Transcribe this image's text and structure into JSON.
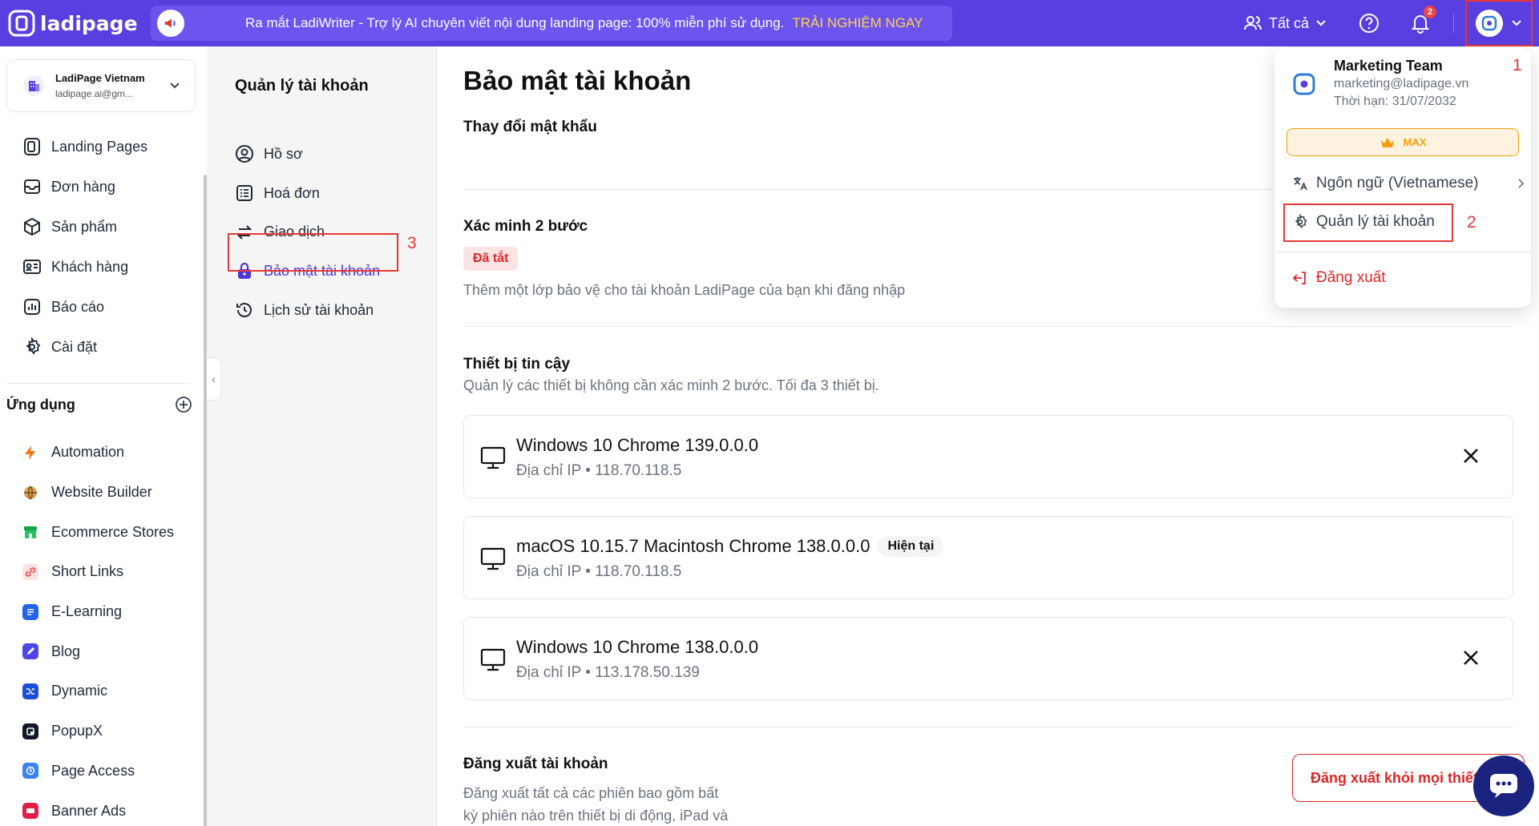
{
  "topbar": {
    "logo_text": "ladipage",
    "banner_text": "Ra mắt LadiWriter - Trợ lý AI chuyên viết nội dung landing page: 100% miễn phí sử dụng.",
    "banner_cta": "TRẢI NGHIỆM NGAY",
    "scope_label": "Tất cả",
    "notification_count": "2",
    "colors": {
      "bar": "#5a3fe0",
      "banner": "#6d54ef",
      "cta": "#ffd54a"
    }
  },
  "account": {
    "name": "LadiPage Vietnam",
    "email": "ladipage.ai@gm..."
  },
  "sidebar": {
    "nav": [
      {
        "label": "Landing Pages",
        "icon": "landing-pages-icon"
      },
      {
        "label": "Đơn hàng",
        "icon": "orders-icon"
      },
      {
        "label": "Sản phẩm",
        "icon": "products-icon"
      },
      {
        "label": "Khách hàng",
        "icon": "customers-icon"
      },
      {
        "label": "Báo cáo",
        "icon": "reports-icon"
      },
      {
        "label": "Cài đặt",
        "icon": "settings-icon"
      }
    ],
    "apps_title": "Ứng dụng",
    "apps": [
      {
        "label": "Automation",
        "icon": "automation-icon",
        "color": "#f97316"
      },
      {
        "label": "Website Builder",
        "icon": "website-builder-icon",
        "color": "#a16207"
      },
      {
        "label": "Ecommerce Stores",
        "icon": "ecommerce-icon",
        "color": "#16a34a"
      },
      {
        "label": "Short Links",
        "icon": "short-links-icon",
        "color": "#ef4444"
      },
      {
        "label": "E-Learning",
        "icon": "elearning-icon",
        "color": "#2563eb"
      },
      {
        "label": "Blog",
        "icon": "blog-icon",
        "color": "#4f46e5"
      },
      {
        "label": "Dynamic",
        "icon": "dynamic-icon",
        "color": "#1d4ed8"
      },
      {
        "label": "PopupX",
        "icon": "popupx-icon",
        "color": "#111827"
      },
      {
        "label": "Page Access",
        "icon": "page-access-icon",
        "color": "#3b82f6"
      },
      {
        "label": "Banner Ads",
        "icon": "banner-ads-icon",
        "color": "#e11d48"
      }
    ]
  },
  "subnav": {
    "title": "Quản lý tài khoản",
    "items": [
      {
        "label": "Hồ sơ",
        "icon": "profile-icon"
      },
      {
        "label": "Hoá đơn",
        "icon": "invoice-icon"
      },
      {
        "label": "Giao dịch",
        "icon": "transaction-icon"
      },
      {
        "label": "Bảo mật tài khoản",
        "icon": "lock-icon"
      },
      {
        "label": "Lịch sử tài khoản",
        "icon": "history-icon"
      }
    ]
  },
  "main": {
    "title": "Bảo mật tài khoản",
    "change_password": "Thay đổi mật khẩu",
    "two_factor_title": "Xác minh 2 bước",
    "two_factor_status": "Đã tắt",
    "two_factor_desc": "Thêm một lớp bảo vệ cho tài khoản LadiPage của bạn khi đăng nhập",
    "trusted_title": "Thiết bị tin cậy",
    "trusted_desc": "Quản lý các thiết bị không cần xác minh 2 bước. Tối đa 3 thiết bị.",
    "ip_prefix": "Địa chỉ IP •",
    "devices": [
      {
        "name": "Windows 10 Chrome 139.0.0.0",
        "ip": "118.70.118.5",
        "current_label": ""
      },
      {
        "name": "macOS 10.15.7 Macintosh Chrome 138.0.0.0",
        "ip": "118.70.118.5",
        "current_label": "Hiện tại"
      },
      {
        "name": "Windows 10 Chrome 138.0.0.0",
        "ip": "113.178.50.139",
        "current_label": ""
      }
    ],
    "logout_title": "Đăng xuất tài khoản",
    "logout_desc_1": "Đăng xuất tất cả các phiên bao gồm bất",
    "logout_desc_2": "kỳ phiên nào trên thiết bị di động, iPad và",
    "logout_all_button": "Đăng xuất khỏi mọi thiết bị"
  },
  "dropdown": {
    "name": "Marketing Team",
    "email": "marketing@ladipage.vn",
    "expiry": "Thời hạn: 31/07/2032",
    "plan": "MAX",
    "language": "Ngôn ngữ (Vietnamese)",
    "account_manage": "Quản lý tài khoản",
    "logout": "Đăng xuất"
  },
  "annotations": {
    "step1": "1",
    "step2": "2",
    "step3": "3"
  }
}
